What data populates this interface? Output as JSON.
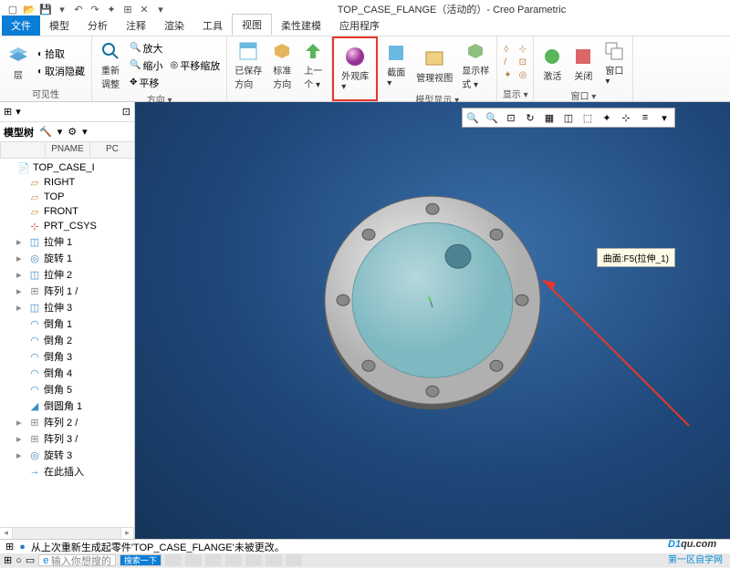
{
  "window": {
    "title": "TOP_CASE_FLANGE（活动的）- Creo Parametric"
  },
  "menu": {
    "file": "文件",
    "tabs": [
      "模型",
      "分析",
      "注释",
      "渲染",
      "工具",
      "视图",
      "柔性建模",
      "应用程序"
    ],
    "active": 5
  },
  "ribbon": {
    "groups": {
      "visibility": {
        "label": "可见性",
        "items": [
          "拾取",
          "取消隐藏",
          "层"
        ]
      },
      "layers": {
        "layers": "重新\n调整"
      },
      "orient": {
        "label": "方向 ▾",
        "zoomin": "放大",
        "zoomout": "缩小",
        "pan": "平移",
        "panzoom": "平移缩放"
      },
      "orient2": {
        "saved": "已保存\n方向",
        "std": "标准\n方向",
        "prev": "上一\n个 ▾"
      },
      "appearance": {
        "label": "外观库\n▾",
        "highlighted": true
      },
      "modeldisp": {
        "label": "模型显示 ▾",
        "section": "截面\n▾",
        "mgr": "管理视图",
        "style": "显示样\n式 ▾"
      },
      "show": {
        "label": "显示 ▾"
      },
      "window": {
        "label": "窗口 ▾",
        "activate": "激活",
        "close": "关闭",
        "win": "窗口\n▾"
      }
    }
  },
  "sidebar": {
    "label": "模型树",
    "columns": [
      "",
      "PNAME",
      "PC"
    ],
    "tree": [
      {
        "exp": "",
        "ico": "part",
        "txt": "TOP_CASE_I",
        "lvl": 0
      },
      {
        "exp": "",
        "ico": "plane",
        "txt": "RIGHT",
        "lvl": 1
      },
      {
        "exp": "",
        "ico": "plane",
        "txt": "TOP",
        "lvl": 1
      },
      {
        "exp": "",
        "ico": "plane",
        "txt": "FRONT",
        "lvl": 1
      },
      {
        "exp": "",
        "ico": "csys",
        "txt": "PRT_CSYS",
        "lvl": 1
      },
      {
        "exp": "▸",
        "ico": "extrude",
        "txt": "拉伸 1",
        "lvl": 1
      },
      {
        "exp": "▸",
        "ico": "revolve",
        "txt": "旋转 1",
        "lvl": 1
      },
      {
        "exp": "▸",
        "ico": "extrude",
        "txt": "拉伸 2",
        "lvl": 1
      },
      {
        "exp": "▸",
        "ico": "pattern",
        "txt": "阵列 1 /",
        "lvl": 1
      },
      {
        "exp": "▸",
        "ico": "extrude",
        "txt": "拉伸 3",
        "lvl": 1
      },
      {
        "exp": "",
        "ico": "round",
        "txt": "倒角 1",
        "lvl": 1
      },
      {
        "exp": "",
        "ico": "round",
        "txt": "倒角 2",
        "lvl": 1
      },
      {
        "exp": "",
        "ico": "round",
        "txt": "倒角 3",
        "lvl": 1
      },
      {
        "exp": "",
        "ico": "round",
        "txt": "倒角 4",
        "lvl": 1
      },
      {
        "exp": "",
        "ico": "round",
        "txt": "倒角 5",
        "lvl": 1
      },
      {
        "exp": "",
        "ico": "chamfer",
        "txt": "倒圆角 1",
        "lvl": 1
      },
      {
        "exp": "▸",
        "ico": "pattern",
        "txt": "阵列 2 /",
        "lvl": 1
      },
      {
        "exp": "▸",
        "ico": "pattern",
        "txt": "阵列 3 /",
        "lvl": 1
      },
      {
        "exp": "▸",
        "ico": "revolve",
        "txt": "旋转 3",
        "lvl": 1
      },
      {
        "exp": "",
        "ico": "insert",
        "txt": "在此插入",
        "lvl": 1
      }
    ]
  },
  "canvas": {
    "tooltip": "曲面:F5(拉伸_1)"
  },
  "status": {
    "msg": "从上次重新生成起零件'TOP_CASE_FLANGE'未被更改。"
  },
  "taskbar": {
    "search_placeholder": "输入你想搜的",
    "button": "搜索一下"
  },
  "watermark": {
    "brand": "D1",
    "suffix": "qu.com",
    "sub": "第一区自学网"
  }
}
